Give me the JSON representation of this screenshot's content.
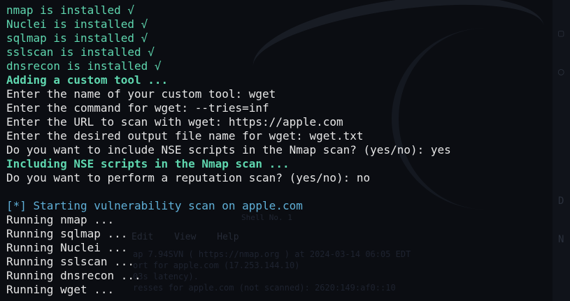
{
  "colors": {
    "background": "#0b0d12",
    "installed_text": "#5fd7af",
    "heading_text": "#5fd7af",
    "info_text": "#5fafd7",
    "normal_text": "#e6e6e6"
  },
  "terminal": {
    "lines": [
      "nmap is installed √",
      "Nuclei is installed √",
      "sqlmap is installed √",
      "sslscan is installed √",
      "dnsrecon is installed √",
      "Adding a custom tool ...",
      "Enter the name of your custom tool: wget",
      "Enter the command for wget: --tries=inf",
      "Enter the URL to scan with wget: https://apple.com",
      "Enter the desired output file name for wget: wget.txt",
      "Do you want to include NSE scripts in the Nmap scan? (yes/no): yes",
      "Including NSE scripts in the Nmap scan ...",
      "Do you want to perform a reputation scan? (yes/no): no",
      "[*] Starting vulnerability scan on apple.com",
      "Running nmap ...",
      "Running sqlmap ...",
      "Running Nuclei ...",
      "Running sslscan ...",
      "Running dnsrecon ...",
      "Running wget ..."
    ]
  },
  "background_window": {
    "menu": [
      "Edit",
      "View",
      "Help"
    ],
    "title": "Shell No. 1",
    "lines": [
      "ap 7.94SVN ( https://nmap.org ) at 2024-03-14 06:05 EDT",
      "ort for apple.com (17.253.144.10)",
      "03s latency).",
      "resses for apple.com (not scanned): 2620:149:af0::10"
    ]
  }
}
